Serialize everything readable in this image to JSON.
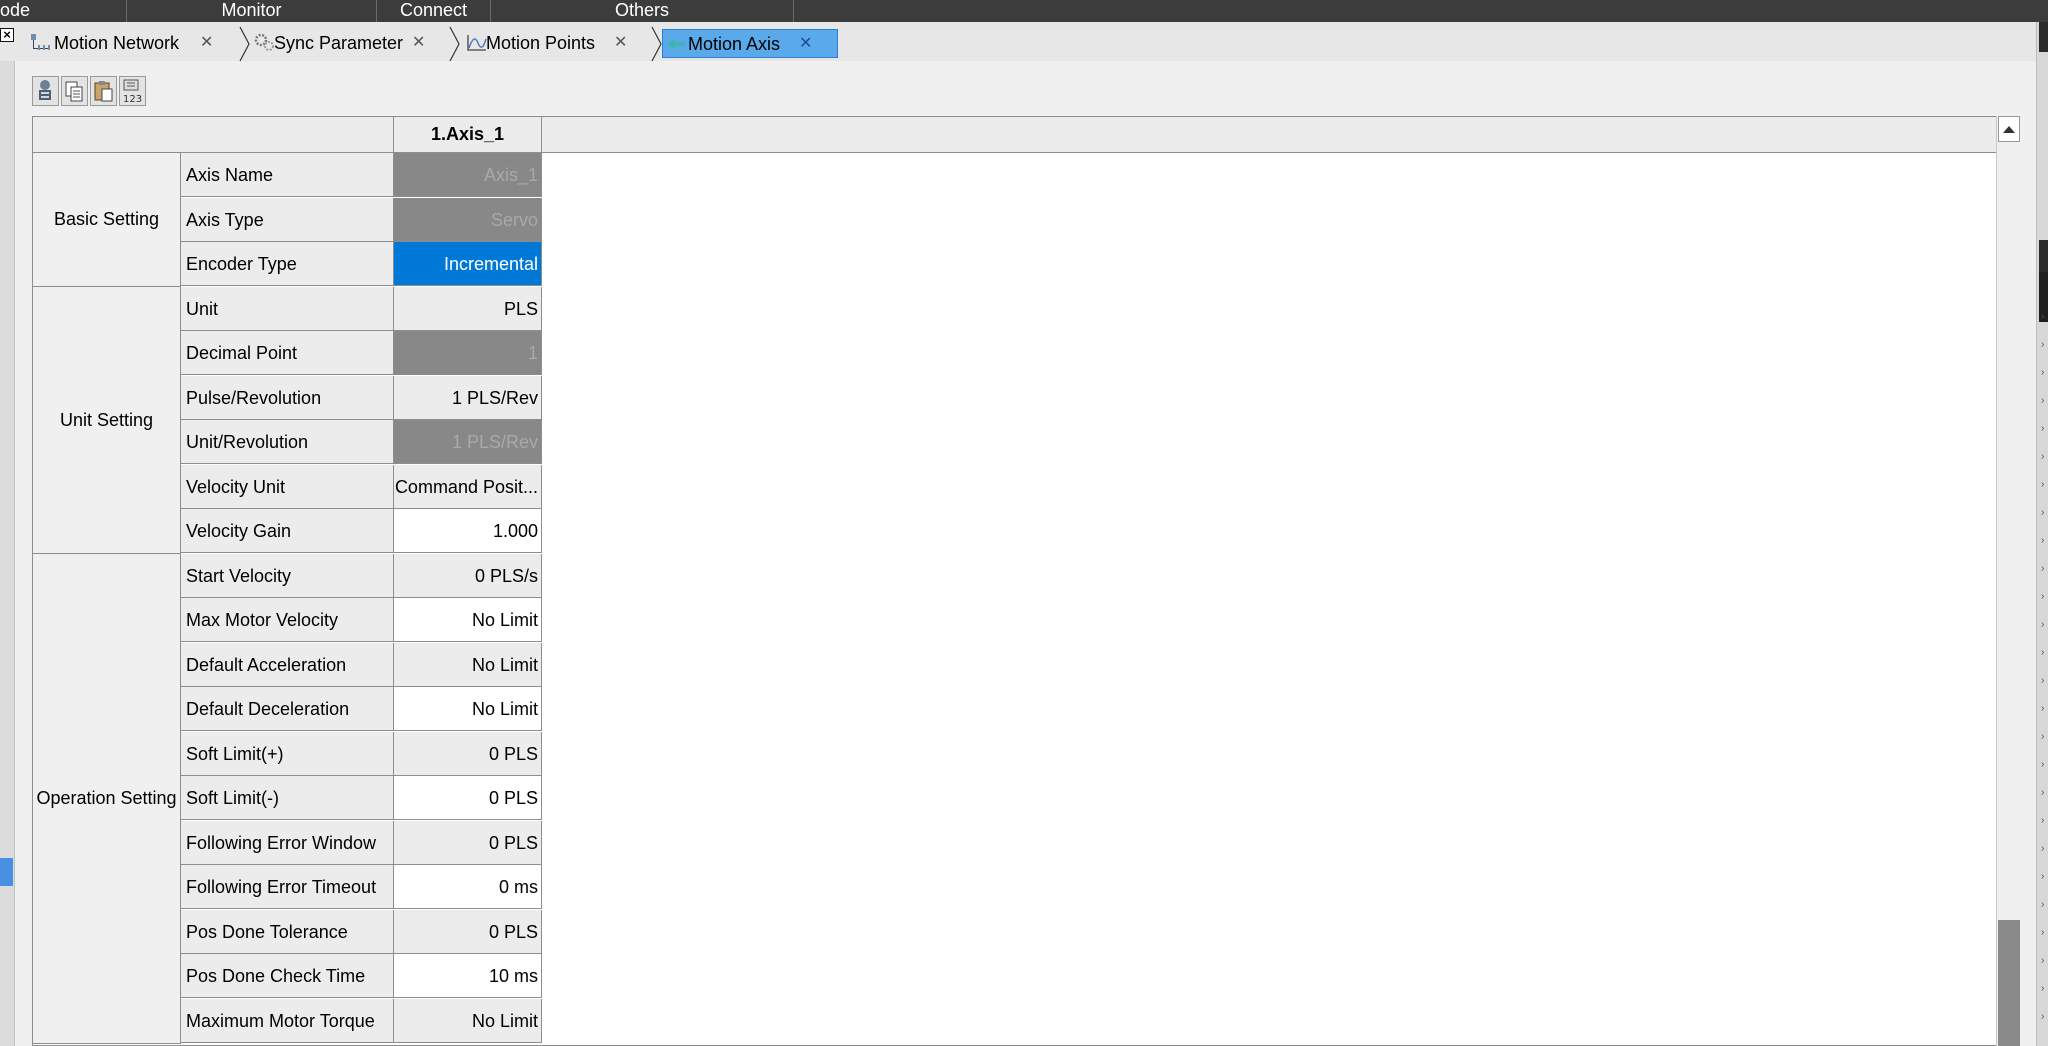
{
  "menu": [
    "ode",
    "Monitor",
    "Connect",
    "Others"
  ],
  "tabs": [
    {
      "label": "Motion Network",
      "close": "✕",
      "icon": "network-icon"
    },
    {
      "label": "Sync Parameter",
      "close": "✕",
      "icon": "gears-icon"
    },
    {
      "label": "Motion Points",
      "close": "✕",
      "icon": "chart-points-icon"
    },
    {
      "label": "Motion Axis",
      "close": "✕",
      "icon": "motion-axis-icon",
      "active": true
    }
  ],
  "toolbar": [
    "monitor-icon",
    "copy-icon",
    "paste-icon",
    "numbering-123-icon"
  ],
  "table": {
    "column_header": "1.Axis_1",
    "groups": [
      {
        "name": "Basic Setting",
        "rows": [
          {
            "label": "Axis Name",
            "value": "Axis_1",
            "state": "disabled"
          },
          {
            "label": "Axis Type",
            "value": "Servo",
            "state": "disabled"
          },
          {
            "label": "Encoder Type",
            "value": "Incremental",
            "state": "selected"
          }
        ]
      },
      {
        "name": "Unit Setting",
        "rows": [
          {
            "label": "Unit",
            "value": "PLS",
            "state": "gray"
          },
          {
            "label": "Decimal Point",
            "value": "1",
            "state": "disabled"
          },
          {
            "label": "Pulse/Revolution",
            "value": "1 PLS/Rev",
            "state": "gray"
          },
          {
            "label": "Unit/Revolution",
            "value": "1 PLS/Rev",
            "state": "disabled"
          },
          {
            "label": "Velocity Unit",
            "value": "Command Posit...",
            "state": "gray"
          },
          {
            "label": "Velocity Gain",
            "value": "1.000",
            "state": "white"
          }
        ]
      },
      {
        "name": "Operation Setting",
        "rows": [
          {
            "label": "Start Velocity",
            "value": "0 PLS/s",
            "state": "gray"
          },
          {
            "label": "Max Motor Velocity",
            "value": "No Limit",
            "state": "white"
          },
          {
            "label": "Default Acceleration",
            "value": "No Limit",
            "state": "gray"
          },
          {
            "label": "Default Deceleration",
            "value": "No Limit",
            "state": "white"
          },
          {
            "label": "Soft Limit(+)",
            "value": "0 PLS",
            "state": "gray"
          },
          {
            "label": "Soft Limit(-)",
            "value": "0 PLS",
            "state": "white"
          },
          {
            "label": "Following Error Window",
            "value": "0 PLS",
            "state": "gray"
          },
          {
            "label": "Following Error Timeout",
            "value": "0 ms",
            "state": "white"
          },
          {
            "label": "Pos Done Tolerance",
            "value": "0 PLS",
            "state": "gray"
          },
          {
            "label": "Pos Done Check Time",
            "value": "10 ms",
            "state": "white"
          },
          {
            "label": "Maximum Motor Torque",
            "value": "No Limit",
            "state": "gray"
          }
        ]
      }
    ]
  },
  "colors": {
    "menu_bg": "#3c3c3c",
    "active_tab": "#5aa9ea",
    "selected_cell": "#0078d7",
    "disabled_cell": "#888888"
  }
}
